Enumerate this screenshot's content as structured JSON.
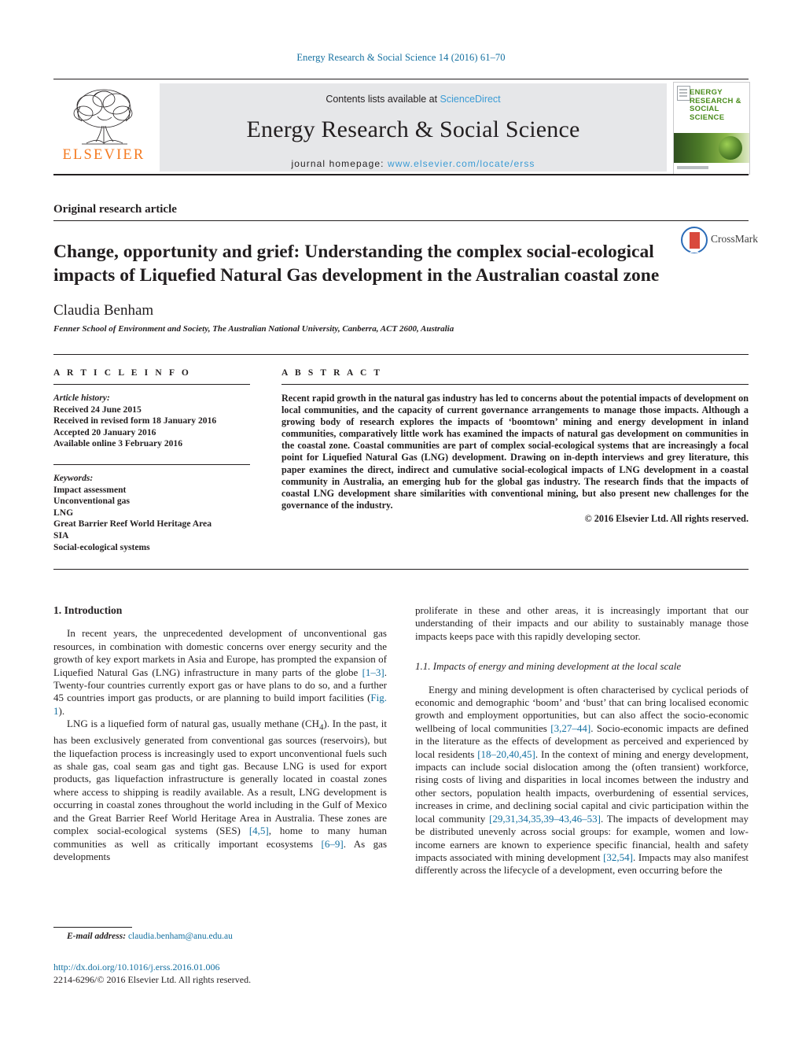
{
  "running_head": "Energy Research & Social Science 14 (2016) 61–70",
  "masthead": {
    "contents_prefix": "Contents lists available at ",
    "sciencedirect_link": "ScienceDirect",
    "journal_title": "Energy Research & Social Science",
    "homepage_label": "journal homepage:",
    "homepage_url": "www.elsevier.com/locate/erss",
    "publisher_wordmark": "ELSEVIER",
    "publisher_logo_icon": "elsevier-tree-icon",
    "cover_title": "ENERGY RESEARCH & SOCIAL SCIENCE",
    "accent_link_color": "#3a9bd5",
    "publisher_color": "#f47a20",
    "band_color": "#e6e7e9"
  },
  "article": {
    "type_label": "Original research article",
    "title": "Change, opportunity and grief: Understanding the complex social-ecological impacts of Liquefied Natural Gas development in the Australian coastal zone",
    "author": "Claudia Benham",
    "affiliation": "Fenner School of Environment and Society, The Australian National University, Canberra, ACT 2600, Australia",
    "crossmark_label": "CrossMark"
  },
  "article_info": {
    "heading": "A R T I C L E   I N F O",
    "history_label": "Article history:",
    "history": [
      "Received 24 June 2015",
      "Received in revised form 18 January 2016",
      "Accepted 20 January 2016",
      "Available online 3 February 2016"
    ],
    "keywords_label": "Keywords:",
    "keywords": [
      "Impact assessment",
      "Unconventional gas",
      "LNG",
      "Great Barrier Reef World Heritage Area",
      "SIA",
      "Social-ecological systems"
    ]
  },
  "abstract": {
    "heading": "A B S T R A C T",
    "text": "Recent rapid growth in the natural gas industry has led to concerns about the potential impacts of development on local communities, and the capacity of current governance arrangements to manage those impacts. Although a growing body of research explores the impacts of ‘boomtown’ mining and energy development in inland communities, comparatively little work has examined the impacts of natural gas development on communities in the coastal zone. Coastal communities are part of complex social-ecological systems that are increasingly a focal point for Liquefied Natural Gas (LNG) development. Drawing on in-depth interviews and grey literature, this paper examines the direct, indirect and cumulative social-ecological impacts of LNG development in a coastal community in Australia, an emerging hub for the global gas industry. The research finds that the impacts of coastal LNG development share similarities with conventional mining, but also present new challenges for the governance of the industry.",
    "copyright": "© 2016 Elsevier Ltd. All rights reserved."
  },
  "body": {
    "section_1_title": "1.  Introduction",
    "para_1_a": "In recent years, the unprecedented development of unconventional gas resources, in combination with domestic concerns over energy security and the growth of key export markets in Asia and Europe, has prompted the expansion of Liquefied Natural Gas (LNG) infrastructure in many parts of the globe ",
    "para_1_ref1": "[1–3]",
    "para_1_b": ". Twenty-four countries currently export gas or have plans to do so, and a further 45 countries import gas products, or are planning to build import facilities (",
    "para_1_ref2": "Fig. 1",
    "para_1_c": ").",
    "para_2_a": "LNG is a liquefied form of natural gas, usually methane (CH",
    "para_2_sub": "4",
    "para_2_b": "). In the past, it has been exclusively generated from conventional gas sources (reservoirs), but the liquefaction process is increasingly used to export unconventional fuels such as shale gas, coal seam gas and tight gas. Because LNG is used for export products, gas liquefaction infrastructure is generally located in coastal zones where access to shipping is readily available. As a result, LNG development is occurring in coastal zones throughout the world including in the Gulf of Mexico and the Great Barrier Reef World Heritage Area in Australia. These zones are complex social-ecological systems (SES) ",
    "para_2_ref1": "[4,5]",
    "para_2_c": ", home to many human communities as well as critically important ecosystems ",
    "para_2_ref2": "[6–9]",
    "para_2_d": ". As gas developments",
    "para_3": "proliferate in these and other areas, it is increasingly important that our understanding of their impacts and our ability to sustainably manage those impacts keeps pace with this rapidly developing sector.",
    "subsection_11_title": "1.1.  Impacts of energy and mining development at the local scale",
    "para_4_a": "Energy and mining development is often characterised by cyclical periods of economic and demographic ‘boom’ and ‘bust’ that can bring localised economic growth and employment opportunities, but can also affect the socio-economic wellbeing of local communities ",
    "para_4_ref1": "[3,27–44]",
    "para_4_b": ". Socio-economic impacts are defined in the literature as the effects of development as perceived and experienced by local residents ",
    "para_4_ref2": "[18–20,40,45]",
    "para_4_c": ". In the context of mining and energy development, impacts can include social dislocation among the (often transient) workforce, rising costs of living and disparities in local incomes between the industry and other sectors, population health impacts, overburdening of essential services, increases in crime, and declining social capital and civic participation within the local community ",
    "para_4_ref3": "[29,31,34,35,39–43,46–53]",
    "para_4_d": ". The impacts of development may be distributed unevenly across social groups: for example, women and low-income earners are known to experience specific financial, health and safety impacts associated with mining development ",
    "para_4_ref4": "[32,54]",
    "para_4_e": ". Impacts may also manifest differently across the lifecycle of a development, even occurring before the"
  },
  "footer": {
    "email_label": "E-mail address:",
    "email": "claudia.benham@anu.edu.au",
    "doi": "http://dx.doi.org/10.1016/j.erss.2016.01.006",
    "issn_line": "2214-6296/© 2016 Elsevier Ltd. All rights reserved."
  }
}
